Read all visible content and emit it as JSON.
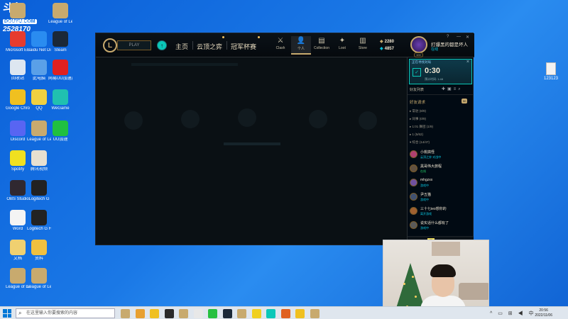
{
  "stream_logo": {
    "line1": "斗鱼",
    "line2": "DOUYU.COM",
    "line3": "2528170"
  },
  "desktop_icons": [
    {
      "label": "",
      "color": "#ffffff"
    },
    {
      "label": "Legend of Legends",
      "color": "#c8aa6e"
    },
    {
      "label": "League of Legends",
      "color": "#c8aa6e"
    },
    {
      "label": "Microsoft E...",
      "color": "#e63b2e"
    },
    {
      "label": "Baidu Net Disk",
      "color": "#2a8cf0"
    },
    {
      "label": "Steam",
      "color": "#1b2838"
    },
    {
      "label": "回收站",
      "color": "#dde6f0"
    },
    {
      "label": "此电脑",
      "color": "#5aa0e8"
    },
    {
      "label": "网易UU加速器",
      "color": "#e02020"
    },
    {
      "label": "Google Chrome",
      "color": "#f0c020"
    },
    {
      "label": "QQ",
      "color": "#f0d040"
    },
    {
      "label": "WeGame",
      "color": "#20c0b0"
    },
    {
      "label": "Discord",
      "color": "#5865f2"
    },
    {
      "label": "League of Legends",
      "color": "#c8aa6e"
    },
    {
      "label": "UU加速",
      "color": "#20c040"
    },
    {
      "label": "Spotify",
      "color": "#f0e020"
    },
    {
      "label": "腾讯视频",
      "color": "#e8e0d0"
    },
    {
      "label": "OBS Studio",
      "color": "#302830"
    },
    {
      "label": "Logitech G",
      "color": "#222222"
    },
    {
      "label": "Word",
      "color": "#f4f4f4"
    },
    {
      "label": "Logitech G HUB",
      "color": "#222222"
    },
    {
      "label": "文档",
      "color": "#f0d070"
    },
    {
      "label": "资料",
      "color": "#f0c040"
    },
    {
      "label": "League of Legends",
      "color": "#c8aa6e"
    },
    {
      "label": "League of Legends",
      "color": "#c8aa6e"
    }
  ],
  "right_file": {
    "label": "123123"
  },
  "client": {
    "play_label": "PLAY",
    "nav": [
      "主页",
      "云顶之弈",
      "冠军杯赛"
    ],
    "top_icons": [
      {
        "glyph": "⚔",
        "label": "Clash"
      },
      {
        "glyph": "👤",
        "label": "个人"
      },
      {
        "glyph": "▤",
        "label": "Collection"
      },
      {
        "glyph": "✦",
        "label": "Loot"
      },
      {
        "glyph": "▥",
        "label": "Store"
      }
    ],
    "blue_essence": "2280",
    "riot_points": "4857",
    "player_name": "打爆黑的都是坏人",
    "player_status": "在线",
    "player_level": "100",
    "window_controls": [
      "?",
      "—",
      "✕"
    ]
  },
  "queue": {
    "title": "正在寻找对局",
    "time": "0:30",
    "estimate": "预计时间: 1:48",
    "close": "×"
  },
  "social": {
    "header": "好友列表",
    "friend_requests": "好友请求",
    "request_count": "50",
    "groups": [
      {
        "name": "▸ 常驻 (8/9)"
      },
      {
        "name": "▸ 同事 (0/9)"
      },
      {
        "name": "▸ 1:01 舞团 (1/9)"
      },
      {
        "name": "▸ 1 (5/62)"
      },
      {
        "name": "▾ 综合 (14/47)"
      }
    ],
    "friends": [
      {
        "name": "小桃搞怪",
        "status": "云顶之弈·对战中",
        "status_color": "#0acbe6",
        "avatar": "#b04070"
      },
      {
        "name": "黑哥伟大旅程",
        "status": "在线",
        "status_color": "#26d06a",
        "avatar": "#605040"
      },
      {
        "name": "mhgzxx",
        "status": "游戏中",
        "status_color": "#0acbe6",
        "avatar": "#7050a0"
      },
      {
        "name": "尹五猫",
        "status": "游戏中",
        "status_color": "#0acbe6",
        "avatar": "#405070"
      },
      {
        "name": "三十七ieo想你的",
        "status": "离开游戏",
        "status_color": "#0acbe6",
        "avatar": "#a06030"
      },
      {
        "name": "说实话什么都有了",
        "status": "游戏中",
        "status_color": "#0acbe6",
        "avatar": "#5a5a5a"
      }
    ],
    "footer_badge": "11"
  },
  "taskbar": {
    "search_placeholder": "在这里输入你要搜索的内容",
    "time": "20:56",
    "date": "2022/11/06"
  },
  "taskbar_apps": [
    "#c8aa6e",
    "#e8a030",
    "#f0c020",
    "#2a2a2a",
    "#c8aa6e",
    "#e8e8e8",
    "#26c040",
    "#1b2838",
    "#c8aa6e",
    "#f0d020",
    "#0ac8b9",
    "#e06020",
    "#f0c020",
    "#c8aa6e"
  ]
}
